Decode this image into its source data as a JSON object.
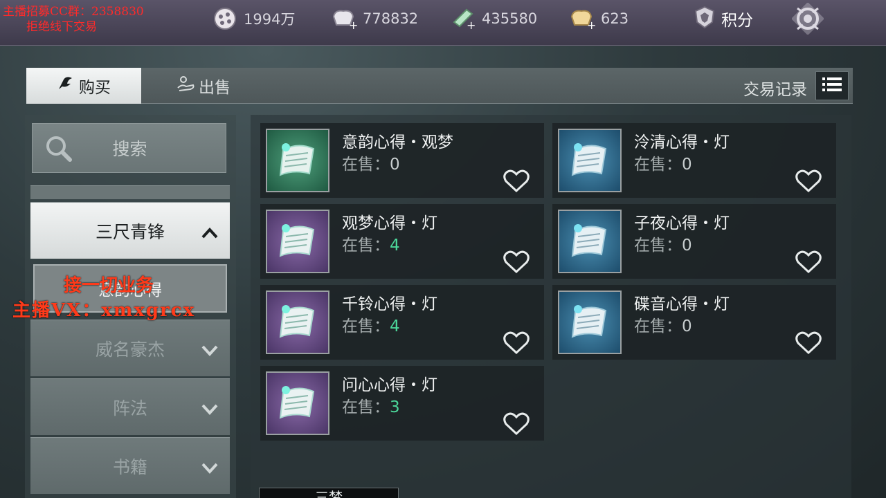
{
  "stream_overlay": {
    "top_line_1": "主播招募CC群：2358830",
    "top_line_2": "拒绝线下交易",
    "mid_line_1": "接一切业务",
    "mid_line_2": "主播VX：xmxgrcx"
  },
  "topbar": {
    "resources": [
      {
        "icon": "coin-icon",
        "value": "1994万"
      },
      {
        "icon": "silver-ingot-add-icon",
        "value": "778832"
      },
      {
        "icon": "jade-add-icon",
        "value": "435580"
      },
      {
        "icon": "gold-ingot-add-icon",
        "value": "623"
      }
    ],
    "points_label": "积分"
  },
  "tabs": {
    "buy_label": "购买",
    "sell_label": "出售",
    "trade_record_label": "交易记录"
  },
  "sidebar": {
    "search_label": "搜索",
    "categories": [
      {
        "label": "三尺青锋",
        "expanded": true
      },
      {
        "label": "威名豪杰",
        "expanded": false
      },
      {
        "label": "阵法",
        "expanded": false
      },
      {
        "label": "书籍",
        "expanded": false
      }
    ],
    "selected_subcategory": "意韵心得"
  },
  "listing": {
    "on_sale_prefix": "在售：",
    "items": [
      {
        "name": "意韵心得・观梦",
        "on_sale": "0",
        "frame": "green"
      },
      {
        "name": "泠清心得・灯",
        "on_sale": "0",
        "frame": "blue"
      },
      {
        "name": "观梦心得・灯",
        "on_sale": "4",
        "frame": "purple"
      },
      {
        "name": "子夜心得・灯",
        "on_sale": "0",
        "frame": "blue"
      },
      {
        "name": "千铃心得・灯",
        "on_sale": "4",
        "frame": "purple"
      },
      {
        "name": "碟音心得・灯",
        "on_sale": "0",
        "frame": "blue"
      },
      {
        "name": "问心心得・灯",
        "on_sale": "3",
        "frame": "purple"
      }
    ]
  },
  "bottom_tab_label": "三梦"
}
